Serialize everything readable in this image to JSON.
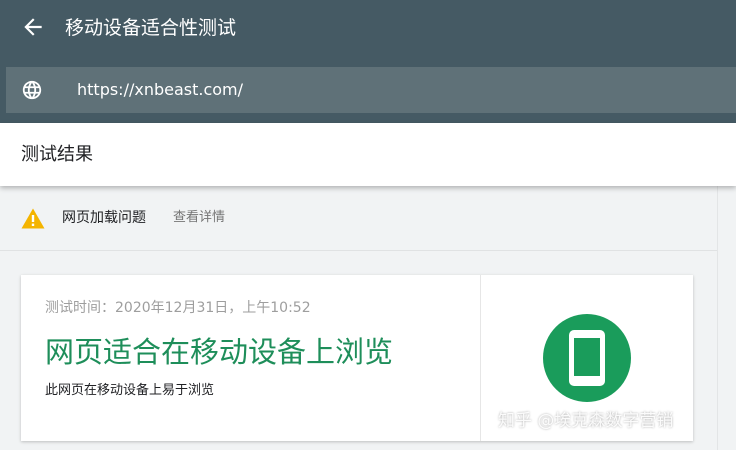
{
  "header": {
    "back_icon": "arrow-left-icon",
    "title": "移动设备适合性测试"
  },
  "url_bar": {
    "icon": "globe-icon",
    "url": "https://xnbeast.com/"
  },
  "results": {
    "title": "测试结果"
  },
  "issue": {
    "icon": "warning-icon",
    "label": "网页加载问题",
    "link": "查看详情",
    "icon_color": "#f4b400"
  },
  "result_card": {
    "test_time": "测试时间：2020年12月31日，上午10:52",
    "verdict": "网页适合在移动设备上浏览",
    "verdict_sub": "此网页在移动设备上易于浏览",
    "icon": "mobile-phone-icon",
    "verdict_color": "#1e8e5a",
    "badge_color": "#1a9c5b"
  },
  "watermark": {
    "text": "知乎 @埃克森数字营销"
  },
  "colors": {
    "topbar": "#455a64",
    "url_bar": "#5f7178",
    "background": "#f1f3f4"
  }
}
